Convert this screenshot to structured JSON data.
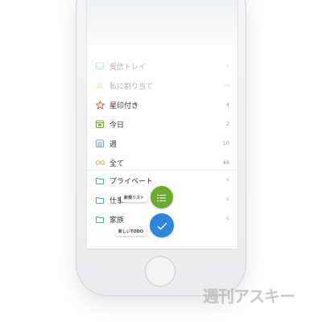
{
  "lists": [
    {
      "label": "受信トレイ",
      "count": "1",
      "icon": "inbox-icon",
      "color": "#8ab4d8",
      "faded": true
    },
    {
      "label": "私に割り当て",
      "count": "10",
      "icon": "person-icon",
      "color": "#e0a24a",
      "faded": true
    },
    {
      "label": "星印付き",
      "count": "4",
      "icon": "star-icon",
      "color": "#e05a4a"
    },
    {
      "label": "今日",
      "count": "2",
      "icon": "calendar-icon",
      "color": "#6aab2f"
    },
    {
      "label": "週",
      "count": "10",
      "icon": "week-icon",
      "color": "#8a9bc4"
    },
    {
      "label": "全て",
      "count": "48",
      "icon": "infinity-icon",
      "color": "#c9a34a"
    }
  ],
  "folders": [
    {
      "label": "プライベート",
      "chevron": "‹",
      "color": "#5b9bd5"
    },
    {
      "label": "仕事",
      "chevron": "‹",
      "color": "#5b9bd5"
    },
    {
      "label": "家族",
      "chevron": "‹",
      "color": "#5b9bd5"
    }
  ],
  "fab": {
    "new_list_label": "新規リスト",
    "new_todo_label": "新しいTODO",
    "green": "#6aab2f",
    "blue": "#2b88d8"
  },
  "watermark": "週刊アスキー"
}
